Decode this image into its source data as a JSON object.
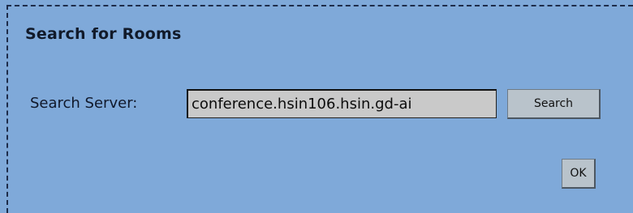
{
  "dialog": {
    "title": "Search for Rooms",
    "search_label": "Search Server:",
    "search_value": "conference.hsin106.hsin.gd-ai",
    "search_button": "Search",
    "ok_button": "OK"
  },
  "colors": {
    "background": "#7fa9d9",
    "input_background": "#c9c9c9",
    "button_background": "#b9c3cb"
  }
}
